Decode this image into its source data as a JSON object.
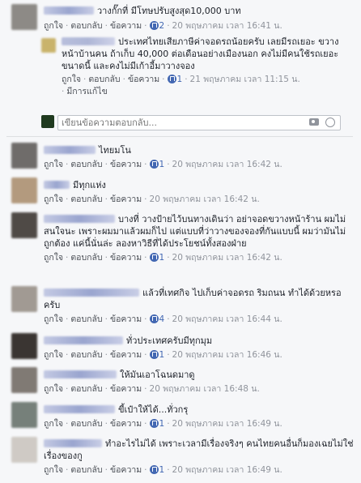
{
  "labels": {
    "like": "ถูกใจ",
    "reply": "ตอบกลับ",
    "message": "ข้อความ",
    "edited": "มีการแก้ไข"
  },
  "reply_input": {
    "placeholder": "เขียนข้อความตอบกลับ..."
  },
  "comments": [
    {
      "text": "วางกั๊กที่ มีโทษปรับสูงสุด10,000 บาท",
      "likes": "2",
      "time": "20 พฤษภาคม เวลา 16:41 น."
    },
    {
      "text": "ประเทศไทยเสียภาษีค่าจอดรถน้อยครับ เลยมีรถเยอะ ขวางหน้าบ้านคน ถ้าเก็บ 40,000 ต่อเดือนอย่างเมืองนอก คงไม่มีคนใช้รถเยอะขนาดนี้ และคงไม่มีเก้าอี้มาวางจอง",
      "likes": "1",
      "time": "21 พฤษภาคม เวลา 11:15 น."
    },
    {
      "text": "ไทยมโน",
      "likes": "1",
      "time": "20 พฤษภาคม เวลา 16:42 น."
    },
    {
      "text": "มีทุกแห่ง",
      "time": "20 พฤษภาคม เวลา 16:42 น."
    },
    {
      "text": "บางที่ วางป้ายไว้บนทางเดินว่า อย่าจอดขวางหน้าร้าน ผมไม่สนใจนะ เพราะผมมาแล้วผมก็ไป แต่แบบที่ว่าวางของจองที่กันแบบนี้ ผมว่ามันไม่ถูกต้อง แค่นี้นั่นล่ะ ลองหาวิธีที่ได้ประโยชน์ทั้งสองฝ่าย",
      "likes": "1",
      "time": "20 พฤษภาคม เวลา 16:42 น."
    },
    {
      "text": "แล้วที่เทศกิจ ไปเก็บค่าจอดรถ ริมถนน ทำได้ด้วยหรอครับ",
      "likes": "4",
      "time": "20 พฤษภาคม เวลา 16:44 น."
    },
    {
      "text": "ทั่วประเทศครับมีทุกมุม",
      "likes": "1",
      "time": "20 พฤษภาคม เวลา 16:46 น."
    },
    {
      "text": "ให้มันเอาโฉนดมาดู",
      "time": "20 พฤษภาคม เวลา 16:48 น."
    },
    {
      "text": "ขี้เป๋าให้ได้...ทั่วกรุ",
      "likes": "1",
      "time": "20 พฤษภาคม เวลา 16:49 น."
    },
    {
      "text": "ทำอะไรไม่ได้ เพราะเวลามีเรื่องจริงๆ คนไทยคนอื่นก็มองเฉยไม่ใช่เรื่องของกู",
      "likes": "1",
      "time": "20 พฤษภาคม เวลา 16:49 น."
    }
  ]
}
